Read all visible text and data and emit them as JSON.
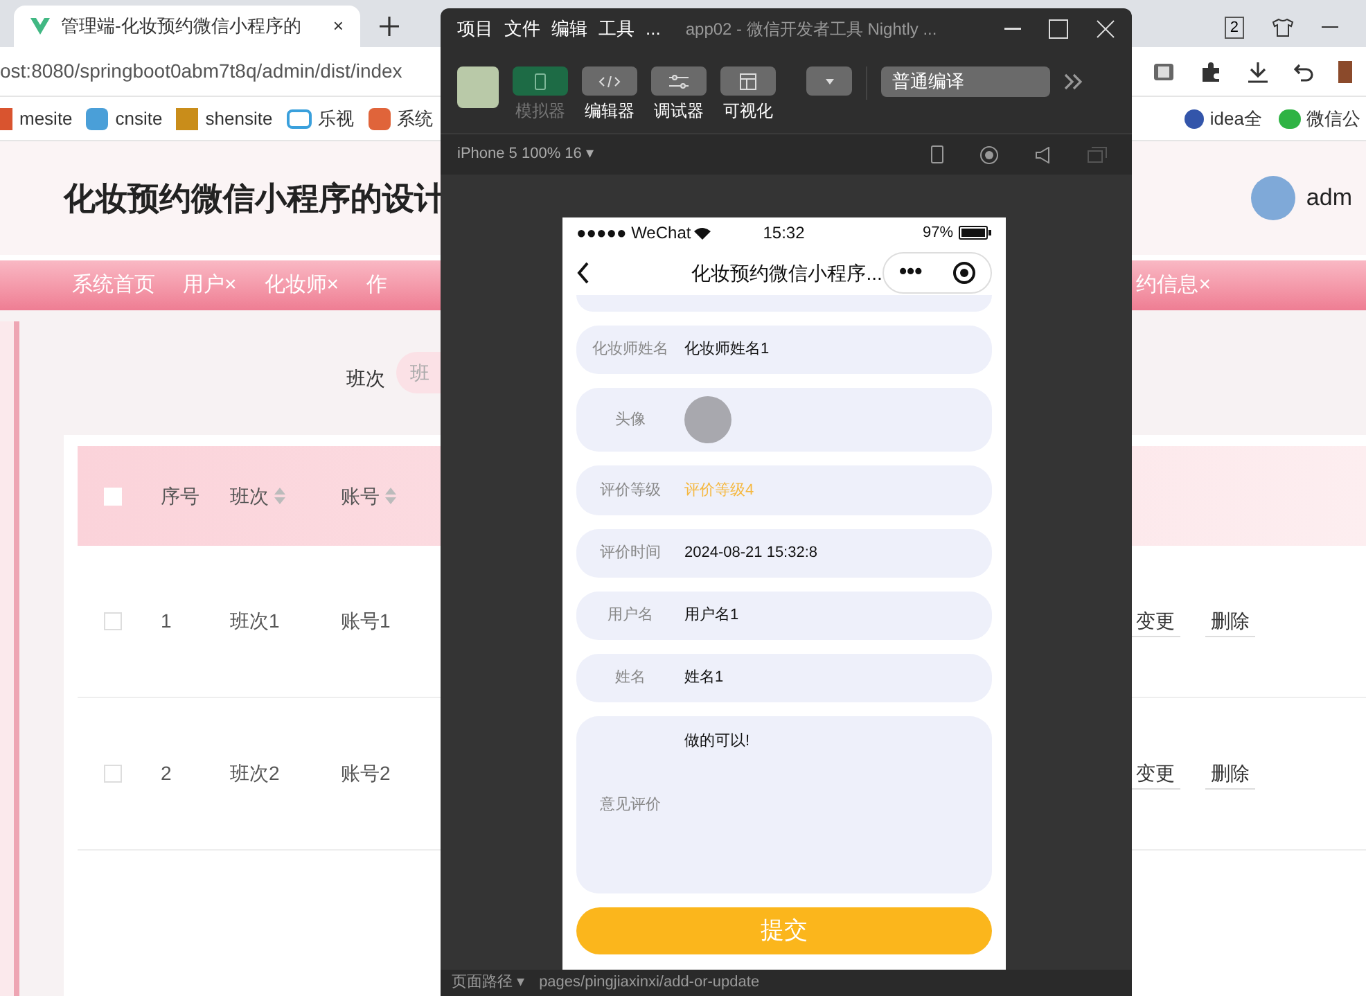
{
  "browser": {
    "tab_title": "管理端-化妆预约微信小程序的",
    "tab_count": "2",
    "address": "ost:8080/springboot0abm7t8q/admin/dist/index",
    "bookmarks": [
      "mesite",
      "cnsite",
      "shensite",
      "乐视",
      "系统"
    ],
    "bookmarks_right": [
      "idea全",
      "微信公"
    ]
  },
  "page": {
    "title": "化妆预约微信小程序的设计",
    "user": "adm",
    "nav_left": [
      {
        "label": "系统首页",
        "closable": false
      },
      {
        "label": "用户",
        "closable": true
      },
      {
        "label": "化妆师",
        "closable": true
      },
      {
        "label": "作",
        "closable": false
      }
    ],
    "nav_right": [
      {
        "label": "约信息",
        "closable": true
      }
    ],
    "close_mark": "×",
    "search_label": "班次",
    "search_placeholder": "班",
    "table": {
      "all_checked": false,
      "columns": [
        "序号",
        "班次",
        "账号"
      ],
      "rows": [
        {
          "checked": false,
          "cells": [
            "1",
            "班次1",
            "账号1"
          ],
          "actions": [
            "变更",
            "删除"
          ]
        },
        {
          "checked": false,
          "cells": [
            "2",
            "班次2",
            "账号2"
          ],
          "actions": [
            "变更",
            "删除"
          ]
        }
      ]
    }
  },
  "devtools": {
    "menus": [
      "项目",
      "文件",
      "编辑",
      "工具",
      "..."
    ],
    "title": "app02 - 微信开发者工具 Nightly ...",
    "tools": [
      {
        "label": "模拟器",
        "selected": true,
        "kind": "phone"
      },
      {
        "label": "编辑器",
        "selected": false,
        "kind": "code"
      },
      {
        "label": "调试器",
        "selected": false,
        "kind": "sliders"
      },
      {
        "label": "可视化",
        "selected": false,
        "kind": "layout"
      }
    ],
    "compile_mode": "普通编译",
    "device": "iPhone 5 100% 16 ▾",
    "path_label": "页面路径 ▾",
    "path": "pages/pingjiaxinxi/add-or-update"
  },
  "phone": {
    "carrier": "●●●●● WeChat",
    "time": "15:32",
    "battery": "97%",
    "title": "化妆预约微信小程序...",
    "capsule_menu": "•••",
    "fields": [
      {
        "kind": "text",
        "label": "化妆师姓名",
        "value": "化妆师姓名1"
      },
      {
        "kind": "image",
        "label": "头像"
      },
      {
        "kind": "rating",
        "label": "评价等级",
        "value": "评价等级4"
      },
      {
        "kind": "text",
        "label": "评价时间",
        "value": "2024-08-21 15:32:8"
      },
      {
        "kind": "text",
        "label": "用户名",
        "value": "用户名1"
      },
      {
        "kind": "text",
        "label": "姓名",
        "value": "姓名1"
      },
      {
        "kind": "textarea",
        "label": "意见评价",
        "value": "做的可以!"
      }
    ],
    "submit": "提交"
  }
}
